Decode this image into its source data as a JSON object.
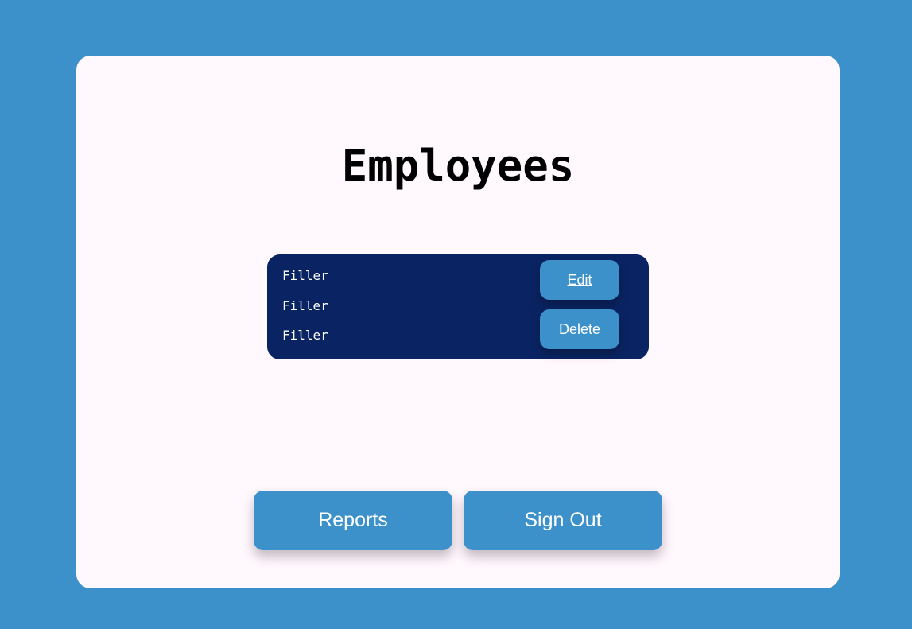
{
  "page": {
    "title": "Employees"
  },
  "employee_card": {
    "fields": [
      "Filler",
      "Filler",
      "Filler"
    ],
    "edit_label": "Edit",
    "delete_label": "Delete"
  },
  "footer": {
    "reports_label": "Reports",
    "signout_label": "Sign Out"
  },
  "colors": {
    "background": "#3d91cb",
    "card": "#fff8fd",
    "employee_card": "#0a2463",
    "button": "#3d91cb",
    "button_text": "#ffffff"
  }
}
